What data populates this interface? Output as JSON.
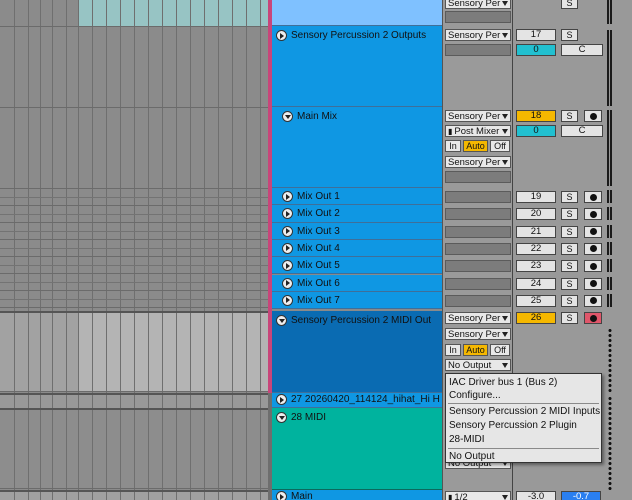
{
  "colors": {
    "arrangement_bg": "#8b8b8b",
    "playhead": "#c8457a",
    "track_blue": "#0f97e3",
    "track_dark_blue": "#0a6bb2",
    "track_teal": "#00b39e",
    "track_top_light": "#7fc1ff",
    "clip_teal": "#97c4c4",
    "active_orange": "#f5b800",
    "volume_cyan": "#22c0d0",
    "arm_red": "#e0566a",
    "main_volume_blue": "#2a7ff0"
  },
  "tracks": {
    "outputs": {
      "name": "Sensory Percussion 2 Outputs",
      "input": "Sensory Per",
      "number": "17",
      "volume": "0",
      "pan": "C",
      "solo": "S"
    },
    "main_mix": {
      "name": "Main Mix",
      "input": "Sensory Per",
      "chain": "Post Mixer",
      "number": "18",
      "volume": "0",
      "pan": "C",
      "solo": "S",
      "monitor": [
        "In",
        "Auto",
        "Off"
      ],
      "output": "Sensory Per"
    },
    "mix_outs": [
      {
        "name": "Mix Out 1",
        "number": "19"
      },
      {
        "name": "Mix Out 2",
        "number": "20"
      },
      {
        "name": "Mix Out 3",
        "number": "21"
      },
      {
        "name": "Mix Out 4",
        "number": "22"
      },
      {
        "name": "Mix Out 5",
        "number": "23"
      },
      {
        "name": "Mix Out 6",
        "number": "24"
      },
      {
        "name": "Mix Out 7",
        "number": "25"
      }
    ],
    "midi_out": {
      "name": "Sensory Percussion 2 MIDI Out",
      "input": "Sensory Per",
      "channel": "Sensory Per",
      "number": "26",
      "solo": "S",
      "monitor": [
        "In",
        "Auto",
        "Off"
      ],
      "output_selected": "No Output"
    },
    "audio_27": {
      "name": "27 20260420_114124_hihat_Hi H"
    },
    "midi_28": {
      "name": "28 MIDI",
      "output_hidden": "No Output"
    },
    "main": {
      "name": "Main",
      "input": "1/2",
      "volume": "-3.0",
      "pan": "-0.7"
    }
  },
  "top": {
    "input": "Sensory Per",
    "solo": "S"
  },
  "dropdown": {
    "group1": [
      "IAC Driver bus 1 (Bus 2)",
      "Configure..."
    ],
    "group2": [
      "Sensory Percussion 2 MIDI Inputs",
      "Sensory Percussion 2 Plugin",
      "28-MIDI"
    ],
    "group3": [
      "No Output"
    ]
  }
}
